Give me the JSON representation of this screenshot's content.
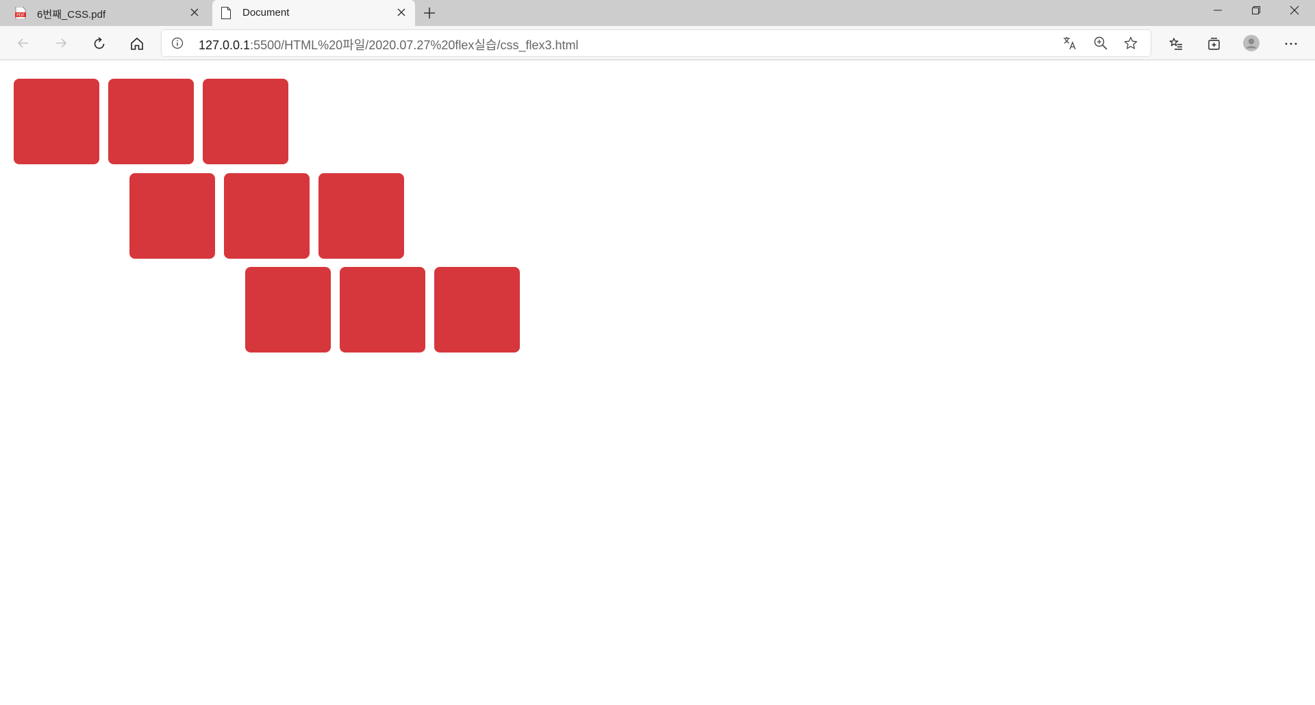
{
  "browser": {
    "tabs": [
      {
        "title": "6번째_CSS.pdf",
        "icon": "pdf-icon",
        "active": false
      },
      {
        "title": "Document",
        "icon": "document-icon",
        "active": true
      }
    ],
    "address": {
      "host": "127.0.0.1",
      "path": ":5500/HTML%20파일/2020.07.27%20flex실습/css_flex3.html"
    }
  },
  "page": {
    "box_color": "#d6373c",
    "rows": [
      {
        "boxes": 3
      },
      {
        "boxes": 3
      },
      {
        "boxes": 3
      }
    ]
  }
}
